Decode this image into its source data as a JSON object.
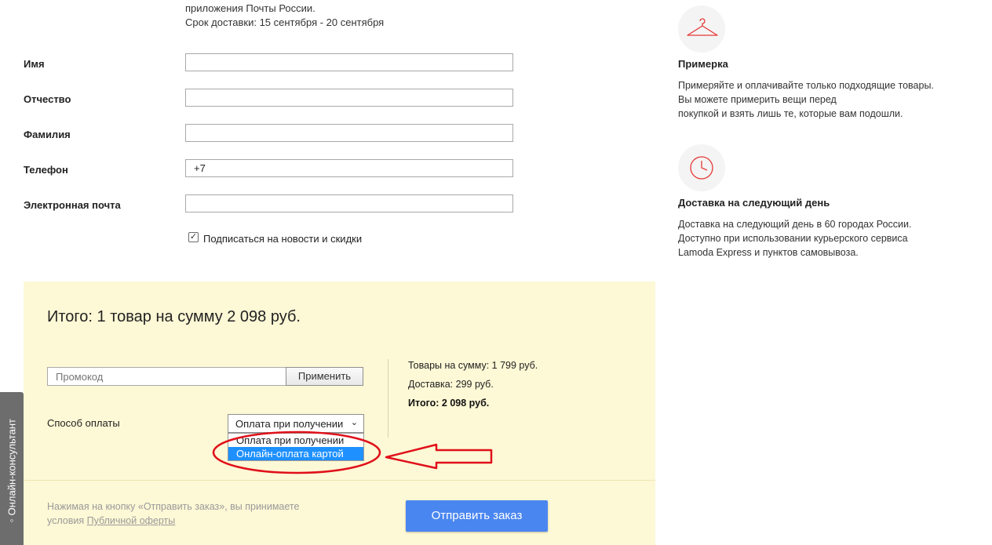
{
  "delivery_info": {
    "line1": "приложения Почты России.",
    "line2": "Срок доставки: 15 сентября - 20 сентября"
  },
  "form": {
    "first_name_label": "Имя",
    "first_name_value": "",
    "patronymic_label": "Отчество",
    "patronymic_value": "",
    "last_name_label": "Фамилия",
    "last_name_value": "",
    "phone_label": "Телефон",
    "phone_value": "+7",
    "email_label": "Электронная почта",
    "email_value": "",
    "subscribe_label": "Подписаться на новости и скидки",
    "subscribe_checked": true
  },
  "order": {
    "total_title": "Итого: 1 товар на сумму 2 098 руб.",
    "promo_placeholder": "Промокод",
    "apply_label": "Применить",
    "payment_label": "Способ оплаты",
    "payment_selected": "Оплата при получении",
    "payment_options": [
      "Оплата при получении",
      "Онлайн-оплата картой"
    ],
    "payment_highlighted": "Онлайн-оплата картой",
    "goods_sum": "Товары на сумму: 1 799 руб.",
    "delivery_sum": "Доставка: 299 руб.",
    "total_sum": "Итого: 2 098 руб.",
    "terms_text": "Нажимая на кнопку «Отправить заказ», вы принимаете",
    "terms_prefix": "условия",
    "terms_link": "Публичной оферты",
    "submit_label": "Отправить заказ"
  },
  "features": [
    {
      "icon": "hanger-icon",
      "title": "Примерка",
      "lines": [
        "Примеряйте и оплачивайте только подходящие товары.",
        "Вы можете примерить вещи перед",
        "покупкой и взять лишь те, которые вам подошли."
      ]
    },
    {
      "icon": "clock-icon",
      "title": "Доставка на следующий день",
      "lines": [
        "Доставка на следующий день в 60 городах России.",
        "Доступно при использовании курьерского сервиса",
        "Lamoda Express и пунктов самовывоза."
      ]
    }
  ],
  "consultant_tab": "Онлайн-консультант",
  "colors": {
    "accent": "#e53935",
    "panel_bg": "#fdf8d5",
    "submit_bg": "#4a86f0",
    "highlight": "#1e90ff",
    "annotation": "#e0101a"
  }
}
